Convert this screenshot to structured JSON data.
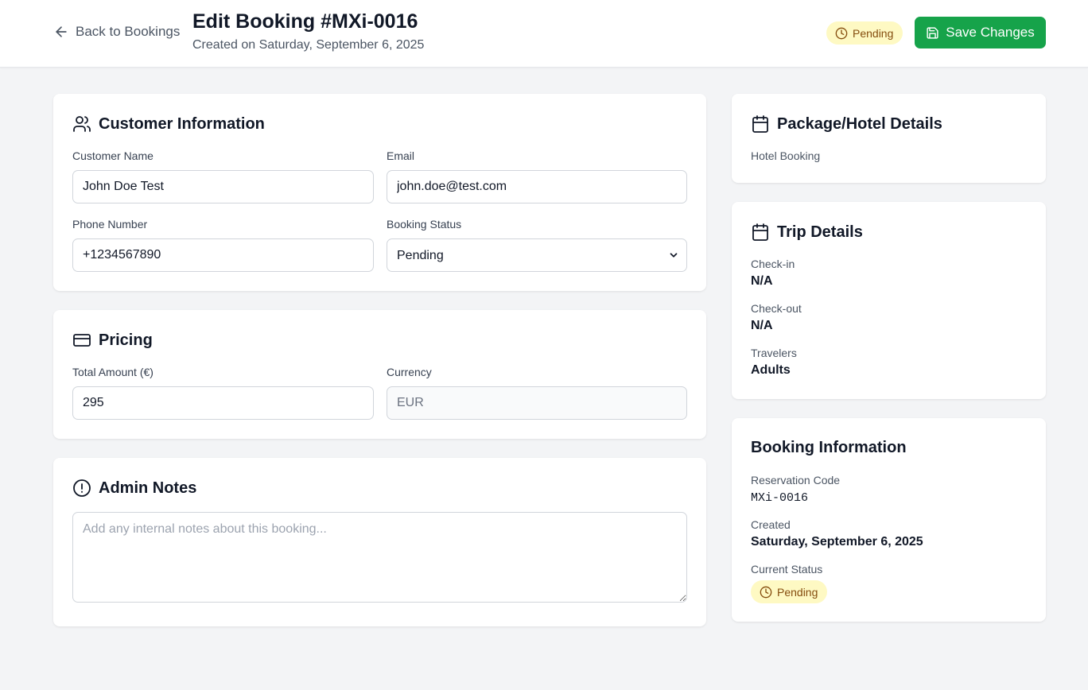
{
  "header": {
    "back_label": "Back to Bookings",
    "title": "Edit Booking #MXi-0016",
    "subtitle": "Created on Saturday, September 6, 2025",
    "status_badge": "Pending",
    "save_label": "Save Changes"
  },
  "customer": {
    "title": "Customer Information",
    "name_label": "Customer Name",
    "name_value": "John Doe Test",
    "email_label": "Email",
    "email_value": "john.doe@test.com",
    "phone_label": "Phone Number",
    "phone_value": "+1234567890",
    "status_label": "Booking Status",
    "status_value": "Pending"
  },
  "pricing": {
    "title": "Pricing",
    "amount_label": "Total Amount (€)",
    "amount_value": "295",
    "currency_label": "Currency",
    "currency_value": "EUR"
  },
  "notes": {
    "title": "Admin Notes",
    "placeholder": "Add any internal notes about this booking..."
  },
  "package": {
    "title": "Package/Hotel Details",
    "type": "Hotel Booking"
  },
  "trip": {
    "title": "Trip Details",
    "checkin_label": "Check-in",
    "checkin_value": "N/A",
    "checkout_label": "Check-out",
    "checkout_value": "N/A",
    "travelers_label": "Travelers",
    "travelers_value": "Adults"
  },
  "booking_info": {
    "title": "Booking Information",
    "code_label": "Reservation Code",
    "code_value": "MXi-0016",
    "created_label": "Created",
    "created_value": "Saturday, September 6, 2025",
    "status_label": "Current Status",
    "status_value": "Pending"
  },
  "colors": {
    "accent_green": "#16a34a",
    "pending_bg": "#fef9c3",
    "pending_text": "#854d0e"
  },
  "icons": [
    "arrow-left-icon",
    "clock-icon",
    "save-icon",
    "users-icon",
    "credit-card-icon",
    "alert-circle-icon",
    "calendar-icon",
    "chevron-down-icon"
  ]
}
